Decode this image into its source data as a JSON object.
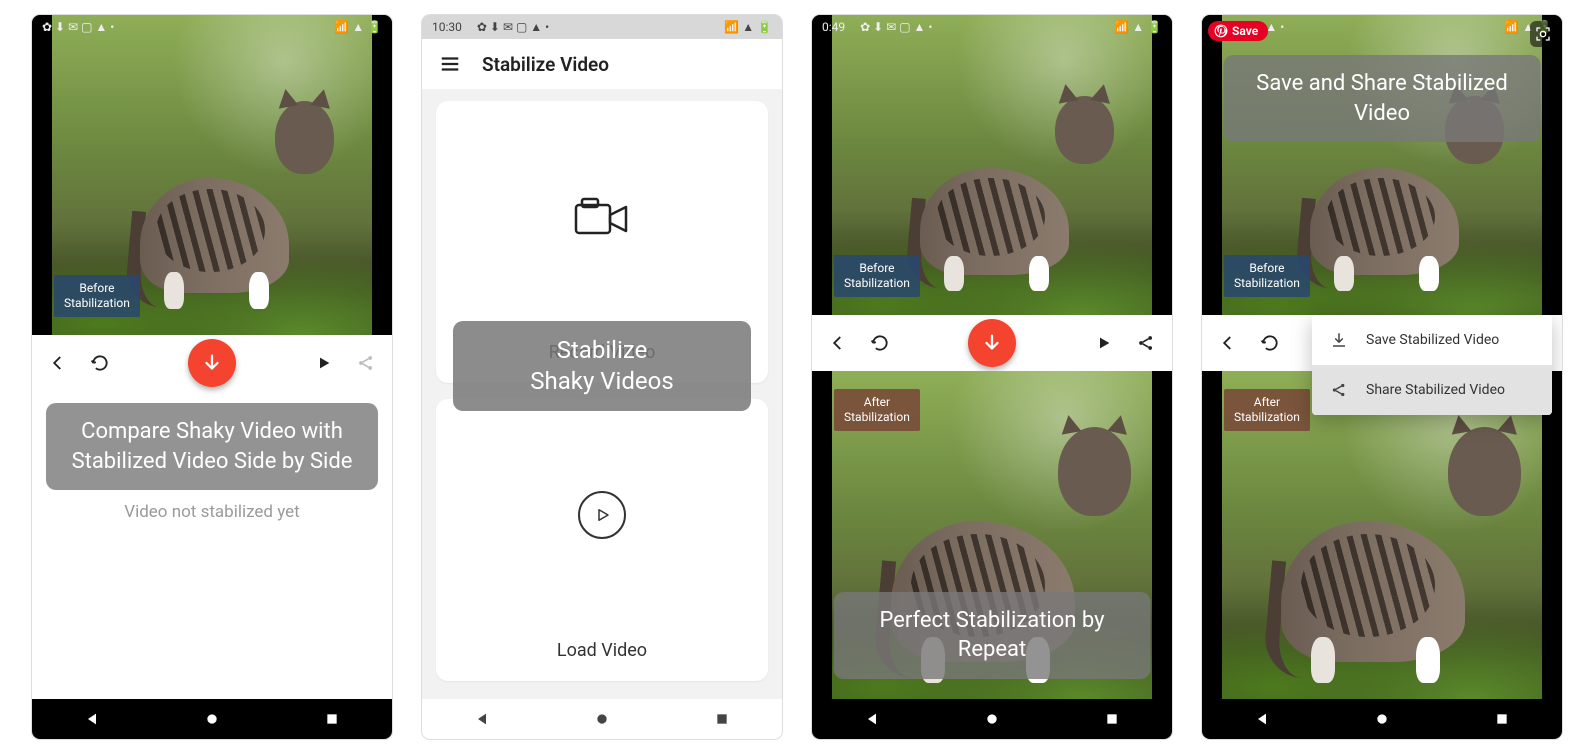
{
  "status": {
    "time_s2": "10:30",
    "time_s3": "0:49",
    "icons_left": "✿ ⬇ ✉ ▢ ▲ •",
    "icons_right": "📶 ▲ 🔋"
  },
  "screen1": {
    "badge_before": "Before\nStabilization",
    "callout": "Compare Shaky Video with Stabilized Video Side by Side",
    "caption": "Video not stabilized yet"
  },
  "screen2": {
    "title": "Stabilize Video",
    "record_label": "Record Video",
    "load_label": "Load Video",
    "callout": "Stabilize\nShaky Videos"
  },
  "screen3": {
    "badge_before": "Before\nStabilization",
    "badge_after": "After\nStabilization",
    "callout": "Perfect Stabilization by Repeat"
  },
  "screen4": {
    "pin_label": "Save",
    "callout_top": "Save and Share Stabilized Video",
    "badge_before": "Before\nStabilization",
    "badge_after": "After\nStabilization",
    "popup_save": "Save Stabilized Video",
    "popup_share": "Share Stabilized Video"
  },
  "icons": {
    "back": "chevron-left-icon",
    "refresh": "refresh-icon",
    "down": "arrow-down-icon",
    "play": "play-icon",
    "share": "share-icon",
    "menu": "menu-icon",
    "camera": "camera-icon",
    "download": "download-icon",
    "nav_back": "nav-back-icon",
    "nav_home": "nav-home-icon",
    "nav_recent": "nav-recent-icon"
  },
  "colors": {
    "accent": "#f4432f",
    "badge_blue": "#3a628e",
    "badge_brown": "#8a5a46"
  }
}
